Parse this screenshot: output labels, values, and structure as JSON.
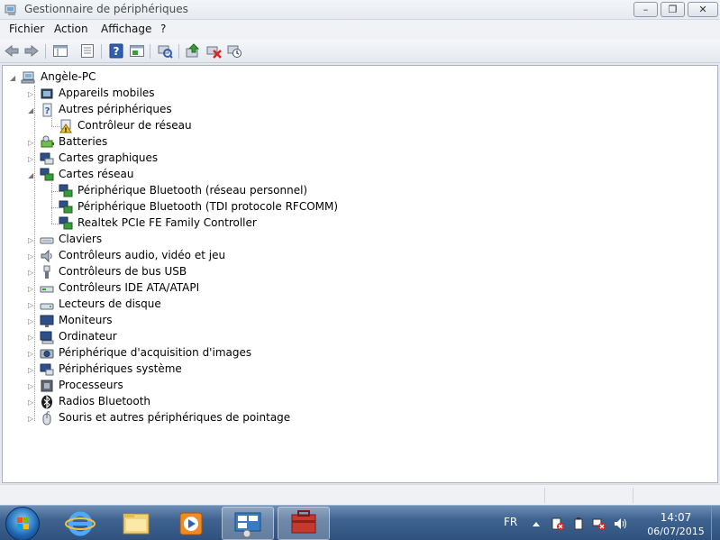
{
  "window": {
    "title": "Gestionnaire de périphériques",
    "title_icon": "device-manager-icon",
    "buttons": {
      "minimize": "–",
      "maximize": "❐",
      "close": "✕"
    }
  },
  "menu": {
    "file": "Fichier",
    "action": "Action",
    "view": "Affichage",
    "help": "?"
  },
  "toolbar": {
    "icons": [
      "back-arrow-icon",
      "forward-arrow-icon",
      "show-hide-tree-icon",
      "properties-icon",
      "help-icon",
      "console-tree-icon",
      "scan-hardware-icon",
      "update-driver-icon",
      "uninstall-icon",
      "disable-icon"
    ]
  },
  "tree": {
    "root": "Angèle-PC",
    "items": [
      {
        "label": "Appareils mobiles",
        "icon": "mobile-device-icon",
        "expanded": false
      },
      {
        "label": "Autres périphériques",
        "icon": "unknown-device-icon",
        "expanded": true,
        "children": [
          {
            "label": "Contrôleur de réseau",
            "icon": "warning-device-icon"
          }
        ]
      },
      {
        "label": "Batteries",
        "icon": "battery-icon",
        "expanded": false
      },
      {
        "label": "Cartes graphiques",
        "icon": "display-adapter-icon",
        "expanded": false
      },
      {
        "label": "Cartes réseau",
        "icon": "network-adapter-icon",
        "expanded": true,
        "children": [
          {
            "label": "Périphérique Bluetooth (réseau personnel)",
            "icon": "network-adapter-icon"
          },
          {
            "label": "Périphérique Bluetooth (TDI protocole RFCOMM)",
            "icon": "network-adapter-icon"
          },
          {
            "label": "Realtek PCIe FE Family Controller",
            "icon": "network-adapter-icon"
          }
        ]
      },
      {
        "label": "Claviers",
        "icon": "keyboard-icon",
        "expanded": false
      },
      {
        "label": "Contrôleurs audio, vidéo et jeu",
        "icon": "speaker-icon",
        "expanded": false
      },
      {
        "label": "Contrôleurs de bus USB",
        "icon": "usb-icon",
        "expanded": false
      },
      {
        "label": "Contrôleurs IDE ATA/ATAPI",
        "icon": "ide-controller-icon",
        "expanded": false
      },
      {
        "label": "Lecteurs de disque",
        "icon": "disk-drive-icon",
        "expanded": false
      },
      {
        "label": "Moniteurs",
        "icon": "monitor-icon",
        "expanded": false
      },
      {
        "label": "Ordinateur",
        "icon": "computer-icon",
        "expanded": false
      },
      {
        "label": "Périphérique d'acquisition d'images",
        "icon": "camera-icon",
        "expanded": false
      },
      {
        "label": "Périphériques système",
        "icon": "system-device-icon",
        "expanded": false
      },
      {
        "label": "Processeurs",
        "icon": "processor-icon",
        "expanded": false
      },
      {
        "label": "Radios Bluetooth",
        "icon": "bluetooth-icon",
        "expanded": false
      },
      {
        "label": "Souris et autres périphériques de pointage",
        "icon": "mouse-icon",
        "expanded": false
      }
    ]
  },
  "taskbar": {
    "pinned": [
      "start-orb-icon",
      "internet-explorer-icon",
      "file-explorer-icon",
      "media-player-icon",
      "control-panel-icon",
      "device-manager-toolbox-icon"
    ],
    "tray": {
      "language": "FR",
      "icons": [
        "show-hidden-icons-icon",
        "action-center-icon",
        "power-icon",
        "network-icon",
        "volume-icon"
      ]
    },
    "time": "14:07",
    "date": "06/07/2015"
  },
  "colors": {
    "taskbar": "#3f6390",
    "tree_background": "#ffffff",
    "title_text": "#4a4a4a"
  }
}
